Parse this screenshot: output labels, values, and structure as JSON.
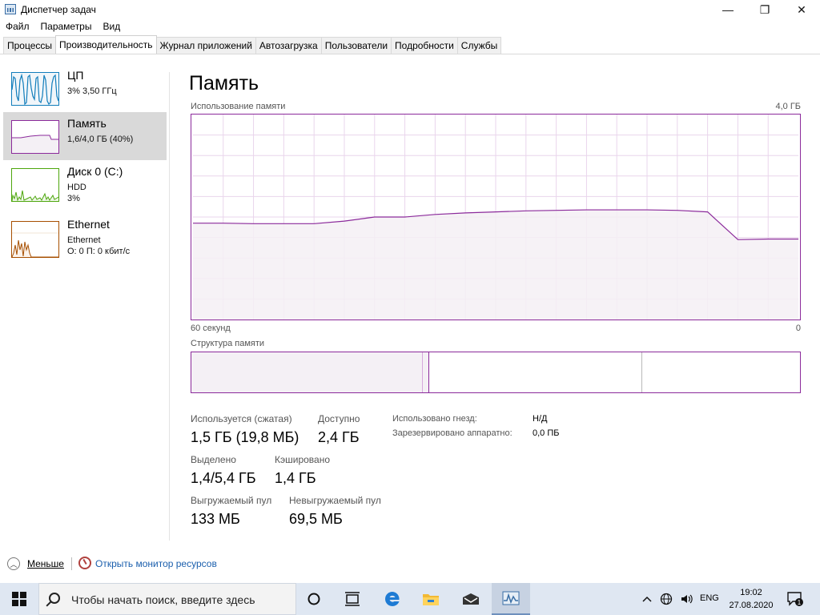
{
  "window": {
    "title": "Диспетчер задач",
    "minimize_glyph": "—",
    "restore_glyph": "❐",
    "close_glyph": "✕"
  },
  "menu": [
    "Файл",
    "Параметры",
    "Вид"
  ],
  "tabs": [
    {
      "label": "Процессы"
    },
    {
      "label": "Производительность",
      "active": true
    },
    {
      "label": "Журнал приложений"
    },
    {
      "label": "Автозагрузка"
    },
    {
      "label": "Пользователи"
    },
    {
      "label": "Подробности"
    },
    {
      "label": "Службы"
    }
  ],
  "resources": [
    {
      "name": "ЦП",
      "line1": "3% 3,50 ГГц",
      "line2": "",
      "color": "#117dbb",
      "fill": "#f1f6fa"
    },
    {
      "name": "Память",
      "line1": "1,6/4,0 ГБ (40%)",
      "line2": "",
      "color": "#8b2a9b",
      "fill": "#f4f0f5",
      "active": true
    },
    {
      "name": "Диск 0 (C:)",
      "line1": "HDD",
      "line2": "3%",
      "color": "#4da60c",
      "fill": "#eff7ea"
    },
    {
      "name": "Ethernet",
      "line1": "Ethernet",
      "line2": "О: 0 П: 0 кбит/с",
      "color": "#a74f01",
      "fill": "#fcf3eb"
    }
  ],
  "main": {
    "title": "Память",
    "usage_label": "Использование памяти",
    "usage_max": "4,0 ГБ",
    "time_left": "60 секунд",
    "time_right": "0",
    "structure_label": "Структура памяти",
    "accent_color": "#8b2a9b",
    "grid_color": "#e9d5ec",
    "fill_color": "#f4f0f5"
  },
  "chart_data": {
    "type": "area",
    "xlabel": "",
    "ylabel": "",
    "ylim": [
      0,
      4.0
    ],
    "x": [
      60,
      57,
      54,
      51,
      48,
      45,
      42,
      39,
      36,
      33,
      30,
      27,
      24,
      21,
      18,
      15,
      12,
      9,
      6,
      3,
      0
    ],
    "values": [
      1.88,
      1.88,
      1.87,
      1.87,
      1.87,
      1.92,
      2.0,
      2.0,
      2.05,
      2.08,
      2.1,
      2.12,
      2.13,
      2.14,
      2.14,
      2.14,
      2.13,
      2.1,
      1.56,
      1.57,
      1.57
    ],
    "grid": true
  },
  "structure": {
    "in_use_fraction": 0.38,
    "modified_fraction": 0.01,
    "standby_fraction": 0.35,
    "free_fraction": 0.26
  },
  "stats": {
    "in_use_label": "Используется (сжатая)",
    "in_use_value": "1,5 ГБ (19,8 МБ)",
    "available_label": "Доступно",
    "available_value": "2,4 ГБ",
    "committed_label": "Выделено",
    "committed_value": "1,4/5,4 ГБ",
    "cached_label": "Кэшировано",
    "cached_value": "1,4 ГБ",
    "paged_label": "Выгружаемый пул",
    "paged_value": "133 МБ",
    "nonpaged_label": "Невыгружаемый пул",
    "nonpaged_value": "69,5 МБ",
    "slots_label": "Использовано гнезд:",
    "slots_value": "Н/Д",
    "reserved_label": "Зарезервировано аппаратно:",
    "reserved_value": "0,0 ПБ"
  },
  "footer": {
    "less_label": "Меньше",
    "monitor_label": "Открыть монитор ресурсов"
  },
  "taskbar": {
    "search_placeholder": "Чтобы начать поиск, введите здесь",
    "lang": "ENG",
    "time": "19:02",
    "date": "27.08.2020",
    "notification_count": "1"
  }
}
